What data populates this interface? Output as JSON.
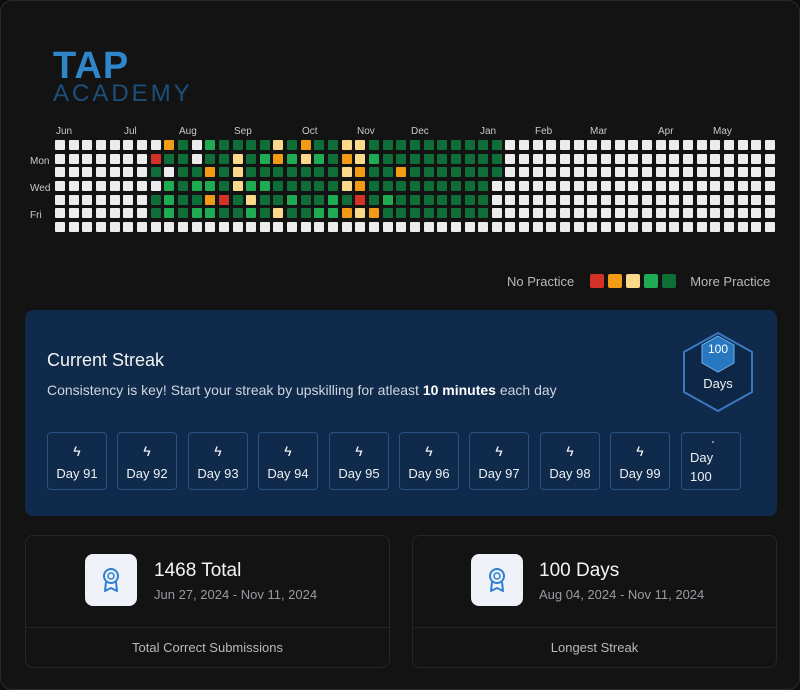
{
  "brand": {
    "line1": "TAP",
    "line2": "ACADEMY"
  },
  "calendar": {
    "months": [
      "Jun",
      "Jul",
      "Aug",
      "Sep",
      "Oct",
      "Nov",
      "Dec",
      "Jan",
      "Feb",
      "Mar",
      "Apr",
      "May"
    ],
    "weekday_labels": [
      "Mon",
      "Wed",
      "Fri"
    ],
    "colors": {
      "empty": "#ececec",
      "red": "#d43226",
      "orange": "#f29b14",
      "yellow": "#fbd98a",
      "green": "#1faa54",
      "dark_green": "#0f6d38"
    }
  },
  "legend": {
    "left_label": "No Practice",
    "right_label": "More Practice",
    "swatches": [
      "#d43226",
      "#f29b14",
      "#fbd98a",
      "#1faa54",
      "#0f6d38"
    ]
  },
  "streak": {
    "title": "Current Streak",
    "subtitle_pre": "Consistency is key! Start your streak by upskilling for atleast ",
    "subtitle_bold": "10 minutes",
    "subtitle_post": " each day",
    "badge_value": "100",
    "badge_label": "Days",
    "days": [
      "Day 91",
      "Day 92",
      "Day 93",
      "Day 94",
      "Day 95",
      "Day 96",
      "Day 97",
      "Day 98",
      "Day 99"
    ],
    "last_day_line1": "Day",
    "last_day_line2": "100"
  },
  "stats": [
    {
      "value": "1468 Total",
      "range": "Jun 27, 2024 - Nov 11, 2024",
      "label": "Total Correct Submissions"
    },
    {
      "value": "100 Days",
      "range": "Aug 04, 2024 - Nov 11, 2024",
      "label": "Longest Streak"
    }
  ]
}
